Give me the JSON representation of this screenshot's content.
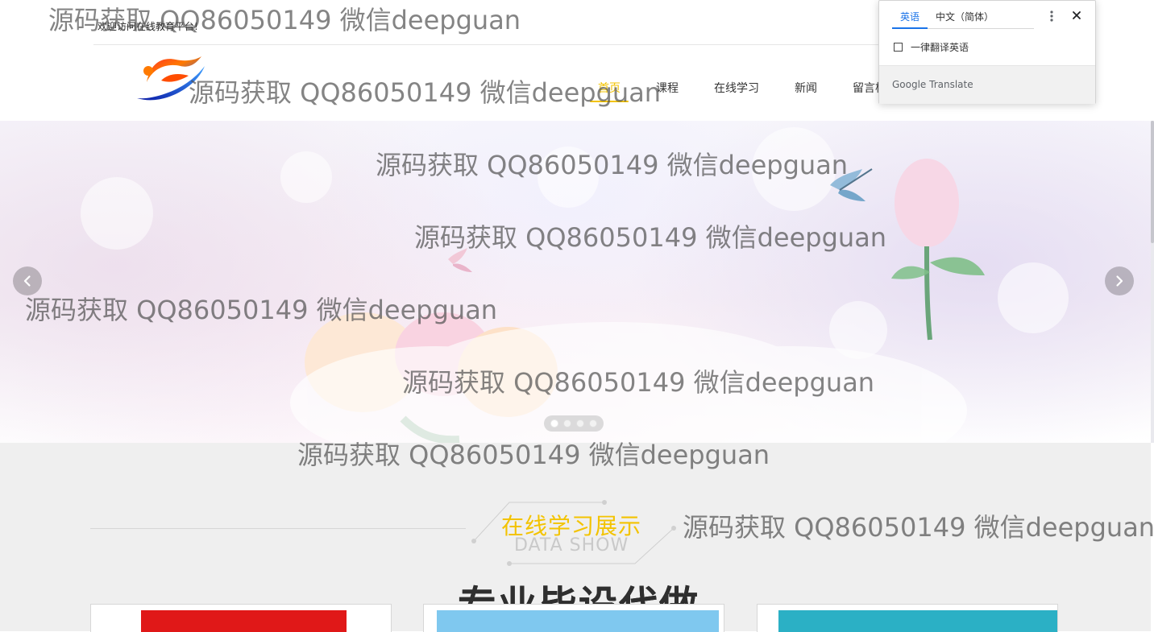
{
  "header": {
    "welcome_text": "欢迎访问在线教育平台!",
    "nav": [
      {
        "label": "首页",
        "active": true
      },
      {
        "label": "课程",
        "active": false
      },
      {
        "label": "在线学习",
        "active": false
      },
      {
        "label": "新闻",
        "active": false
      },
      {
        "label": "留言板",
        "active": false
      }
    ]
  },
  "slider": {
    "prev_icon": "chevron-left-icon",
    "next_icon": "chevron-right-icon",
    "dots_count": 4,
    "active_dot_index": 0
  },
  "section": {
    "title": "在线学习展示",
    "subtitle": "DATA SHOW",
    "accent_color": "#f3c300"
  },
  "promo": {
    "big_text": "专业毕设代做"
  },
  "translate_popup": {
    "tab_source": "英语",
    "tab_target": "中文（简体）",
    "checkbox_label": "一律翻译英语",
    "brand": "Google Translate",
    "more_icon": "more-vert-icon",
    "close_icon": "close-icon"
  },
  "watermarks": [
    "源码获取 QQ86050149 微信deepguan",
    "源码获取 QQ86050149 微信deepguan",
    "源码获取 QQ86050149 微信deepguan",
    "源码获取 QQ86050149 微信deepguan",
    "源码获取 QQ86050149 微信deepguan",
    "源码获取 QQ86050149 微信deepguan",
    "源码获取 QQ86050149 微信deepguan",
    "源码获取 QQ86050149 微信deepguan"
  ]
}
